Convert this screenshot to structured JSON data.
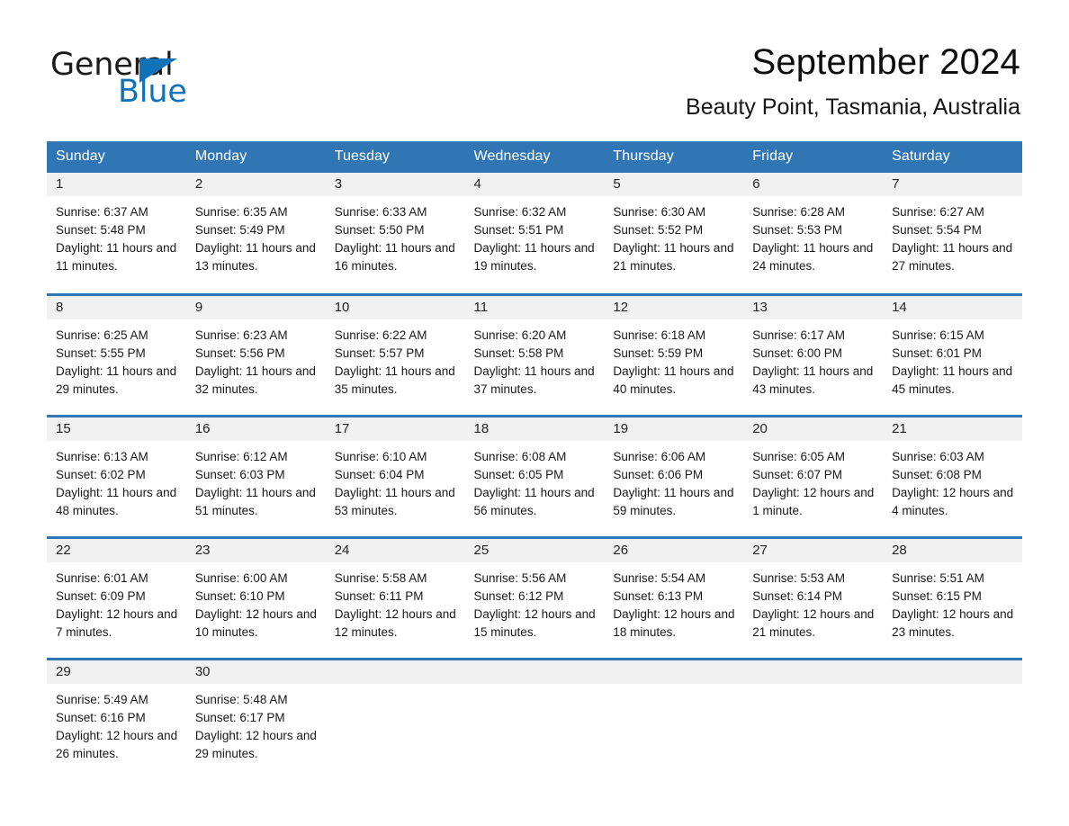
{
  "brand": {
    "name_part1": "General",
    "name_part2": "Blue",
    "flag_icon": "brand-triangle-icon"
  },
  "header": {
    "title": "September 2024",
    "subtitle": "Beauty Point, Tasmania, Australia"
  },
  "colors": {
    "accent_blue": "#3076b4",
    "brand_blue": "#1272b8",
    "daynum_band": "#f1f1f1",
    "header_text": "#ffffff",
    "body_text": "#191919"
  },
  "weekday_headers": [
    "Sunday",
    "Monday",
    "Tuesday",
    "Wednesday",
    "Thursday",
    "Friday",
    "Saturday"
  ],
  "labels": {
    "sunrise_prefix": "Sunrise:",
    "sunset_prefix": "Sunset:",
    "daylight_prefix": "Daylight:"
  },
  "weeks": [
    [
      {
        "day": "1",
        "sunrise": "Sunrise: 6:37 AM",
        "sunset": "Sunset: 5:48 PM",
        "daylight": "Daylight: 11 hours and 11 minutes."
      },
      {
        "day": "2",
        "sunrise": "Sunrise: 6:35 AM",
        "sunset": "Sunset: 5:49 PM",
        "daylight": "Daylight: 11 hours and 13 minutes."
      },
      {
        "day": "3",
        "sunrise": "Sunrise: 6:33 AM",
        "sunset": "Sunset: 5:50 PM",
        "daylight": "Daylight: 11 hours and 16 minutes."
      },
      {
        "day": "4",
        "sunrise": "Sunrise: 6:32 AM",
        "sunset": "Sunset: 5:51 PM",
        "daylight": "Daylight: 11 hours and 19 minutes."
      },
      {
        "day": "5",
        "sunrise": "Sunrise: 6:30 AM",
        "sunset": "Sunset: 5:52 PM",
        "daylight": "Daylight: 11 hours and 21 minutes."
      },
      {
        "day": "6",
        "sunrise": "Sunrise: 6:28 AM",
        "sunset": "Sunset: 5:53 PM",
        "daylight": "Daylight: 11 hours and 24 minutes."
      },
      {
        "day": "7",
        "sunrise": "Sunrise: 6:27 AM",
        "sunset": "Sunset: 5:54 PM",
        "daylight": "Daylight: 11 hours and 27 minutes."
      }
    ],
    [
      {
        "day": "8",
        "sunrise": "Sunrise: 6:25 AM",
        "sunset": "Sunset: 5:55 PM",
        "daylight": "Daylight: 11 hours and 29 minutes."
      },
      {
        "day": "9",
        "sunrise": "Sunrise: 6:23 AM",
        "sunset": "Sunset: 5:56 PM",
        "daylight": "Daylight: 11 hours and 32 minutes."
      },
      {
        "day": "10",
        "sunrise": "Sunrise: 6:22 AM",
        "sunset": "Sunset: 5:57 PM",
        "daylight": "Daylight: 11 hours and 35 minutes."
      },
      {
        "day": "11",
        "sunrise": "Sunrise: 6:20 AM",
        "sunset": "Sunset: 5:58 PM",
        "daylight": "Daylight: 11 hours and 37 minutes."
      },
      {
        "day": "12",
        "sunrise": "Sunrise: 6:18 AM",
        "sunset": "Sunset: 5:59 PM",
        "daylight": "Daylight: 11 hours and 40 minutes."
      },
      {
        "day": "13",
        "sunrise": "Sunrise: 6:17 AM",
        "sunset": "Sunset: 6:00 PM",
        "daylight": "Daylight: 11 hours and 43 minutes."
      },
      {
        "day": "14",
        "sunrise": "Sunrise: 6:15 AM",
        "sunset": "Sunset: 6:01 PM",
        "daylight": "Daylight: 11 hours and 45 minutes."
      }
    ],
    [
      {
        "day": "15",
        "sunrise": "Sunrise: 6:13 AM",
        "sunset": "Sunset: 6:02 PM",
        "daylight": "Daylight: 11 hours and 48 minutes."
      },
      {
        "day": "16",
        "sunrise": "Sunrise: 6:12 AM",
        "sunset": "Sunset: 6:03 PM",
        "daylight": "Daylight: 11 hours and 51 minutes."
      },
      {
        "day": "17",
        "sunrise": "Sunrise: 6:10 AM",
        "sunset": "Sunset: 6:04 PM",
        "daylight": "Daylight: 11 hours and 53 minutes."
      },
      {
        "day": "18",
        "sunrise": "Sunrise: 6:08 AM",
        "sunset": "Sunset: 6:05 PM",
        "daylight": "Daylight: 11 hours and 56 minutes."
      },
      {
        "day": "19",
        "sunrise": "Sunrise: 6:06 AM",
        "sunset": "Sunset: 6:06 PM",
        "daylight": "Daylight: 11 hours and 59 minutes."
      },
      {
        "day": "20",
        "sunrise": "Sunrise: 6:05 AM",
        "sunset": "Sunset: 6:07 PM",
        "daylight": "Daylight: 12 hours and 1 minute."
      },
      {
        "day": "21",
        "sunrise": "Sunrise: 6:03 AM",
        "sunset": "Sunset: 6:08 PM",
        "daylight": "Daylight: 12 hours and 4 minutes."
      }
    ],
    [
      {
        "day": "22",
        "sunrise": "Sunrise: 6:01 AM",
        "sunset": "Sunset: 6:09 PM",
        "daylight": "Daylight: 12 hours and 7 minutes."
      },
      {
        "day": "23",
        "sunrise": "Sunrise: 6:00 AM",
        "sunset": "Sunset: 6:10 PM",
        "daylight": "Daylight: 12 hours and 10 minutes."
      },
      {
        "day": "24",
        "sunrise": "Sunrise: 5:58 AM",
        "sunset": "Sunset: 6:11 PM",
        "daylight": "Daylight: 12 hours and 12 minutes."
      },
      {
        "day": "25",
        "sunrise": "Sunrise: 5:56 AM",
        "sunset": "Sunset: 6:12 PM",
        "daylight": "Daylight: 12 hours and 15 minutes."
      },
      {
        "day": "26",
        "sunrise": "Sunrise: 5:54 AM",
        "sunset": "Sunset: 6:13 PM",
        "daylight": "Daylight: 12 hours and 18 minutes."
      },
      {
        "day": "27",
        "sunrise": "Sunrise: 5:53 AM",
        "sunset": "Sunset: 6:14 PM",
        "daylight": "Daylight: 12 hours and 21 minutes."
      },
      {
        "day": "28",
        "sunrise": "Sunrise: 5:51 AM",
        "sunset": "Sunset: 6:15 PM",
        "daylight": "Daylight: 12 hours and 23 minutes."
      }
    ],
    [
      {
        "day": "29",
        "sunrise": "Sunrise: 5:49 AM",
        "sunset": "Sunset: 6:16 PM",
        "daylight": "Daylight: 12 hours and 26 minutes."
      },
      {
        "day": "30",
        "sunrise": "Sunrise: 5:48 AM",
        "sunset": "Sunset: 6:17 PM",
        "daylight": "Daylight: 12 hours and 29 minutes."
      },
      {
        "day": "",
        "sunrise": "",
        "sunset": "",
        "daylight": ""
      },
      {
        "day": "",
        "sunrise": "",
        "sunset": "",
        "daylight": ""
      },
      {
        "day": "",
        "sunrise": "",
        "sunset": "",
        "daylight": ""
      },
      {
        "day": "",
        "sunrise": "",
        "sunset": "",
        "daylight": ""
      },
      {
        "day": "",
        "sunrise": "",
        "sunset": "",
        "daylight": ""
      }
    ]
  ]
}
